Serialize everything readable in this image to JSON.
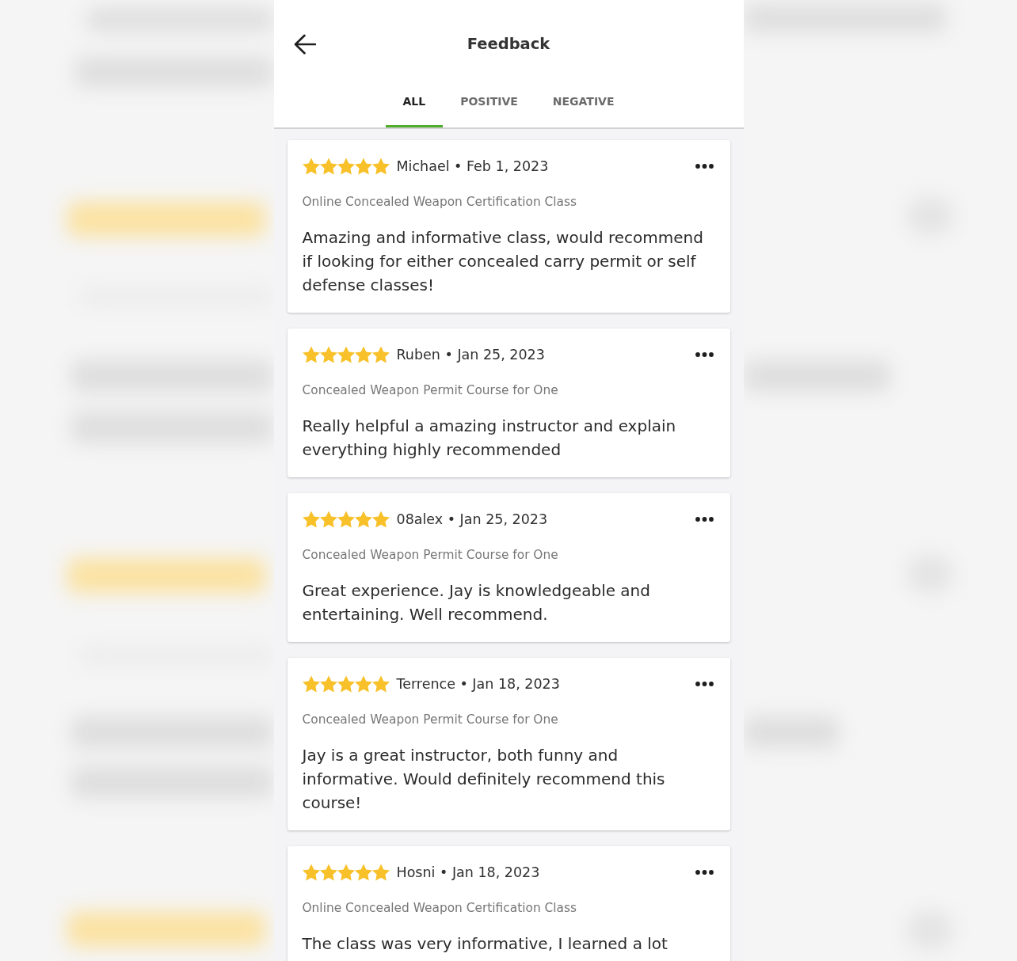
{
  "header": {
    "title": "Feedback"
  },
  "tabs": [
    {
      "label": "ALL",
      "selected": true
    },
    {
      "label": "POSITIVE",
      "selected": false
    },
    {
      "label": "NEGATIVE",
      "selected": false
    }
  ],
  "reviews": [
    {
      "stars": 5,
      "byline": "Michael • Feb 1, 2023",
      "course": "Online Concealed Weapon Certification Class",
      "text": "Amazing and informative class, would recommend if looking for either concealed carry permit or self defense classes!"
    },
    {
      "stars": 5,
      "byline": "Ruben • Jan 25, 2023",
      "course": "Concealed Weapon Permit Course for One",
      "text": "Really helpful a amazing instructor and explain everything highly recommended"
    },
    {
      "stars": 5,
      "byline": "08alex • Jan 25, 2023",
      "course": "Concealed Weapon Permit Course for One",
      "text": "Great experience. Jay is knowledgeable and entertaining. Well recommend."
    },
    {
      "stars": 5,
      "byline": "Terrence • Jan 18, 2023",
      "course": "Concealed Weapon Permit Course for One",
      "text": "Jay is a great instructor, both funny and informative. Would definitely recommend this course!"
    },
    {
      "stars": 5,
      "byline": "Hosni • Jan 18, 2023",
      "course": "Online Concealed Weapon Certification Class",
      "text": "The class was very informative, I learned a lot"
    }
  ]
}
